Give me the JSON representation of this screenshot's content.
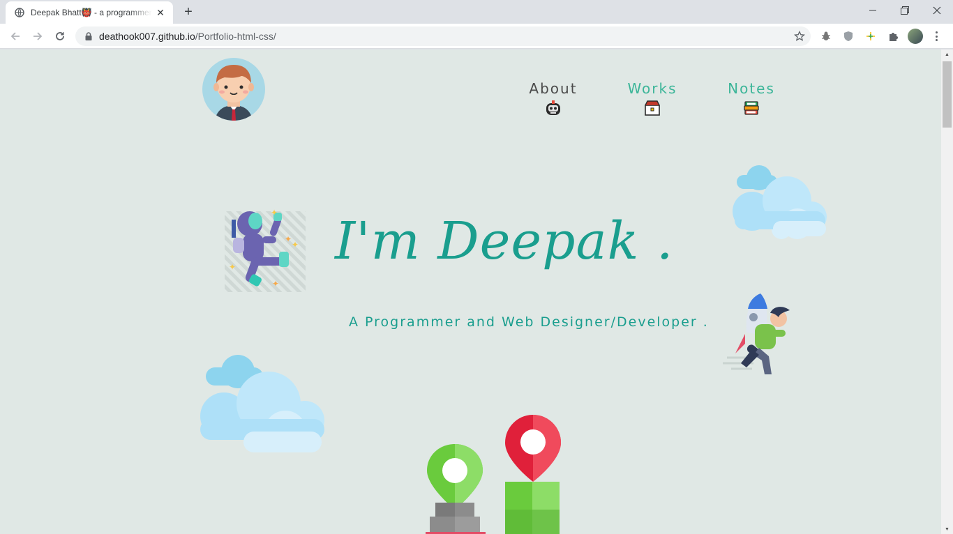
{
  "browser": {
    "tab": {
      "title": "Deepak Bhatt👹 - a programmer",
      "close_symbol": "✕"
    },
    "new_tab_symbol": "+",
    "window": {
      "minimize": "—",
      "restore": "❐",
      "close": "✕"
    },
    "address": {
      "domain": "deathook007.github.io",
      "path": "/Portfolio-html-css/"
    }
  },
  "page": {
    "nav": [
      {
        "label": "About",
        "color": "#4a4a4a",
        "icon": "robot-icon"
      },
      {
        "label": "Works",
        "color": "#3bb598",
        "icon": "briefcase-icon"
      },
      {
        "label": "Notes",
        "color": "#3bb598",
        "icon": "books-icon"
      }
    ],
    "hero": {
      "title": "I'm Deepak .",
      "subtitle": "A Programmer and Web Designer/Developer ."
    }
  },
  "colors": {
    "accent": "#1a9e8e",
    "background": "#e0e8e5"
  }
}
